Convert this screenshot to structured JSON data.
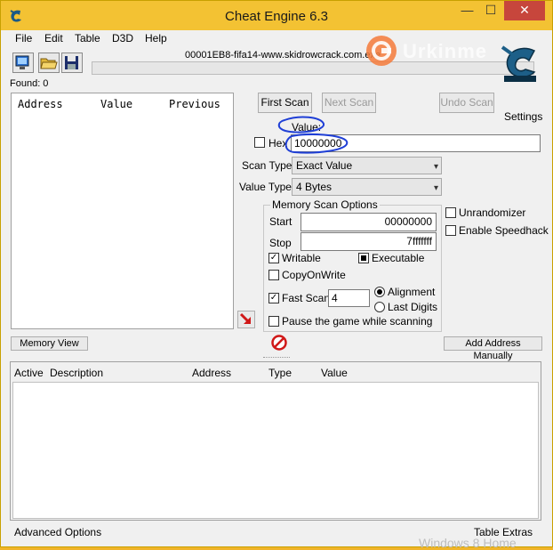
{
  "window": {
    "title": "Cheat Engine 6.3",
    "minimize_glyph": "—",
    "maximize_glyph": "☐",
    "close_glyph": "✕",
    "app_icon": "cheat-engine-icon"
  },
  "menu": [
    "File",
    "Edit",
    "Table",
    "D3D",
    "Help"
  ],
  "toolbar": {
    "process_label": "00001EB8-fifa14-www.skidrowcrack.com.exe",
    "icons": [
      "process-list-icon",
      "open-folder-icon",
      "save-icon"
    ]
  },
  "found": "Found: 0",
  "results_list": {
    "columns": [
      "Address",
      "Value",
      "Previous"
    ]
  },
  "scan": {
    "first_scan": "First Scan",
    "next_scan": "Next Scan",
    "undo_scan": "Undo Scan",
    "settings": "Settings",
    "value_label": "Value:",
    "hex_label": "Hex",
    "value": "10000000",
    "scan_type_label": "Scan Type",
    "scan_type": "Exact Value",
    "value_type_label": "Value Type",
    "value_type": "4 Bytes"
  },
  "memory_options": {
    "title": "Memory Scan Options",
    "start_label": "Start",
    "start": "00000000",
    "stop_label": "Stop",
    "stop": "7fffffff",
    "writable": "Writable",
    "executable": "Executable",
    "copy_on_write": "CopyOnWrite",
    "fast_scan": "Fast Scan",
    "fast_scan_value": "4",
    "alignment": "Alignment",
    "last_digits": "Last Digits",
    "pause_game": "Pause the game while scanning"
  },
  "extra": {
    "unrandomizer": "Unrandomizer",
    "speedhack": "Enable Speedhack"
  },
  "buttons": {
    "memory_view": "Memory View",
    "add_address": "Add Address Manually"
  },
  "address_table": {
    "columns": [
      "Active",
      "Description",
      "Address",
      "Type",
      "Value"
    ]
  },
  "status": {
    "advanced": "Advanced Options",
    "table_extras": "Table Extras"
  },
  "watermark": {
    "brand_text": "Urkinme",
    "corner_text": "Windows 8 Home"
  },
  "colors": {
    "titlebar": "#f3c233",
    "accent_blue": "#1f3fd6",
    "window_bg": "#f0f0f0"
  }
}
